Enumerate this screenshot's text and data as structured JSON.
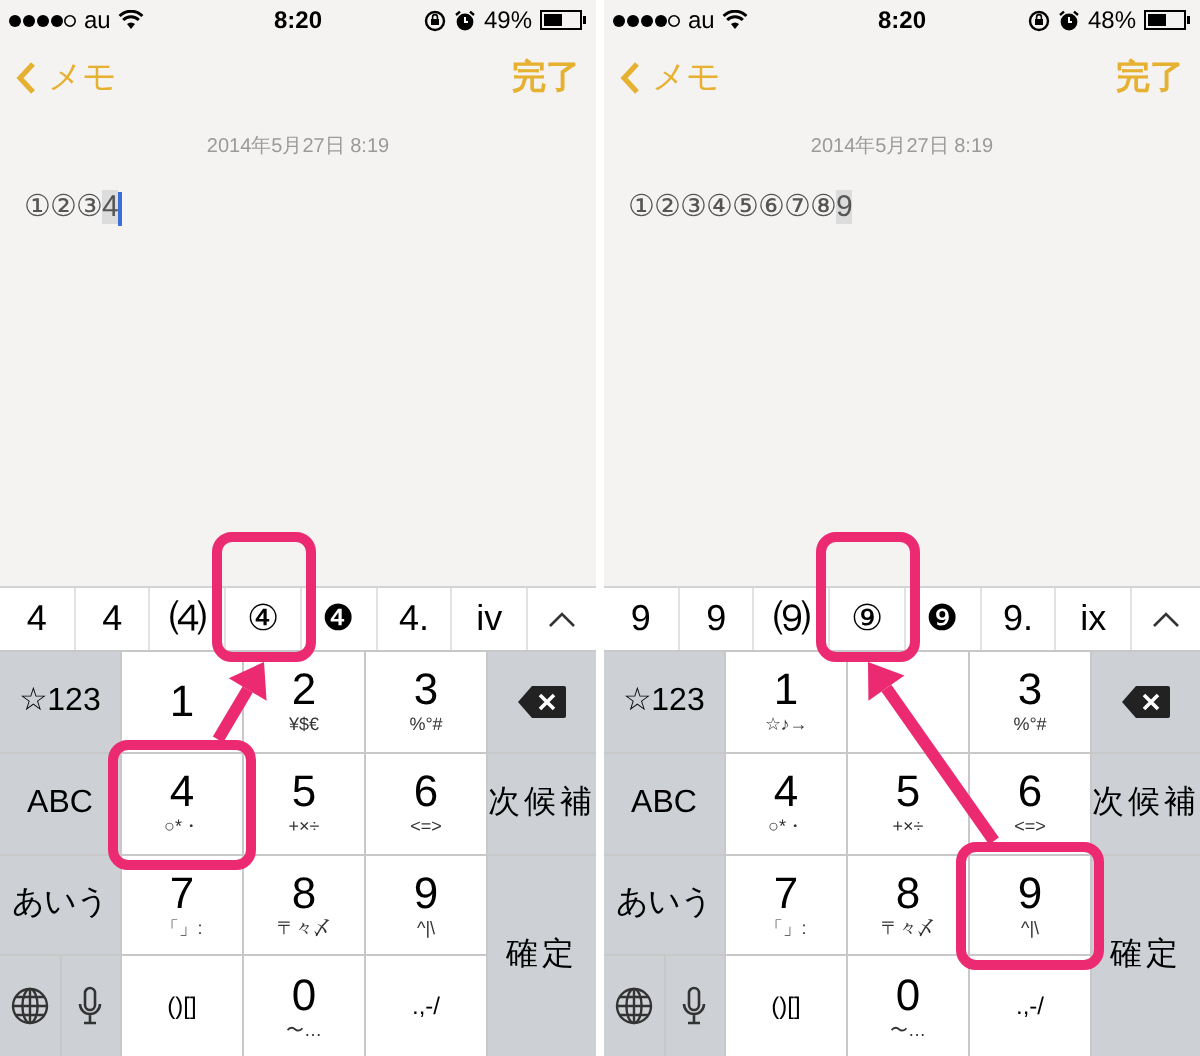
{
  "screens": [
    {
      "status_bar": {
        "carrier": "au",
        "time": "8:20",
        "battery": "49%"
      },
      "nav": {
        "back": "メモ",
        "done": "完了"
      },
      "date": "2014年5月27日 8:19",
      "note": {
        "committed": "①②③",
        "composing": "4",
        "cursor": true
      },
      "candidates": [
        {
          "text": "4",
          "highlighted": false
        },
        {
          "text": "4",
          "highlighted": false
        },
        {
          "text": "⑷",
          "highlighted": false
        },
        {
          "text": "④",
          "highlighted": true
        },
        {
          "text": "❹",
          "highlighted": false
        },
        {
          "text": "4.",
          "highlighted": false
        },
        {
          "text": "iv",
          "highlighted": false
        }
      ],
      "keyboard": {
        "left_keys": [
          "☆123",
          "ABC",
          "あいう"
        ],
        "digit_rows": [
          [
            {
              "kind": "digit",
              "main": "1",
              "highlighted": false
            },
            {
              "kind": "digit",
              "main": "2",
              "sub": "¥$€",
              "highlighted": false
            },
            {
              "kind": "digit",
              "main": "3",
              "sub": "%°#",
              "highlighted": false
            }
          ],
          [
            {
              "kind": "digit",
              "main": "4",
              "sub": "○*・",
              "highlighted": true
            },
            {
              "kind": "digit",
              "main": "5",
              "sub": "+×÷",
              "highlighted": false
            },
            {
              "kind": "digit",
              "main": "6",
              "sub": "<=>",
              "highlighted": false
            }
          ],
          [
            {
              "kind": "digit",
              "main": "7",
              "sub": "「」:",
              "highlighted": false
            },
            {
              "kind": "digit",
              "main": "8",
              "sub": "〒々〆",
              "highlighted": false
            },
            {
              "kind": "digit",
              "main": "9",
              "sub": "^|\\",
              "highlighted": false
            }
          ],
          [
            {
              "kind": "symbol",
              "main": "()[]",
              "highlighted": false
            },
            {
              "kind": "digit",
              "main": "0",
              "sub": "〜…",
              "highlighted": false
            },
            {
              "kind": "symbol",
              "main": ".,-/",
              "highlighted": false
            }
          ]
        ],
        "right_keys": [
          {
            "kind": "delete"
          },
          {
            "kind": "label",
            "label": "次候補"
          },
          {
            "kind": "label",
            "label": "確定"
          }
        ]
      }
    },
    {
      "status_bar": {
        "carrier": "au",
        "time": "8:20",
        "battery": "48%"
      },
      "nav": {
        "back": "メモ",
        "done": "完了"
      },
      "date": "2014年5月27日 8:19",
      "note": {
        "committed": "①②③④⑤⑥⑦⑧",
        "composing": "9",
        "cursor": false
      },
      "candidates": [
        {
          "text": "9",
          "highlighted": false
        },
        {
          "text": "9",
          "highlighted": false
        },
        {
          "text": "⑼",
          "highlighted": false
        },
        {
          "text": "⑨",
          "highlighted": true
        },
        {
          "text": "❾",
          "highlighted": false
        },
        {
          "text": "9.",
          "highlighted": false
        },
        {
          "text": "ix",
          "highlighted": false
        }
      ],
      "keyboard": {
        "left_keys": [
          "☆123",
          "ABC",
          "あいう"
        ],
        "digit_rows": [
          [
            {
              "kind": "digit",
              "main": "1",
              "sub": "☆♪→",
              "highlighted": false
            },
            {
              "kind": "digit",
              "highlighted": false
            },
            {
              "kind": "digit",
              "main": "3",
              "sub": "%°#",
              "highlighted": false
            }
          ],
          [
            {
              "kind": "digit",
              "main": "4",
              "sub": "○*・",
              "highlighted": false
            },
            {
              "kind": "digit",
              "main": "5",
              "sub": "+×÷",
              "highlighted": false
            },
            {
              "kind": "digit",
              "main": "6",
              "sub": "<=>",
              "highlighted": false
            }
          ],
          [
            {
              "kind": "digit",
              "main": "7",
              "sub": "「」:",
              "highlighted": false
            },
            {
              "kind": "digit",
              "main": "8",
              "sub": "〒々〆",
              "highlighted": false
            },
            {
              "kind": "digit",
              "main": "9",
              "sub": "^|\\",
              "highlighted": true
            }
          ],
          [
            {
              "kind": "symbol",
              "main": "()[]",
              "highlighted": false
            },
            {
              "kind": "digit",
              "main": "0",
              "sub": "〜…",
              "highlighted": false
            },
            {
              "kind": "symbol",
              "main": ".,-/",
              "highlighted": false
            }
          ]
        ],
        "right_keys": [
          {
            "kind": "delete"
          },
          {
            "kind": "label",
            "label": "次候補"
          },
          {
            "kind": "label",
            "label": "確定"
          }
        ]
      }
    }
  ]
}
